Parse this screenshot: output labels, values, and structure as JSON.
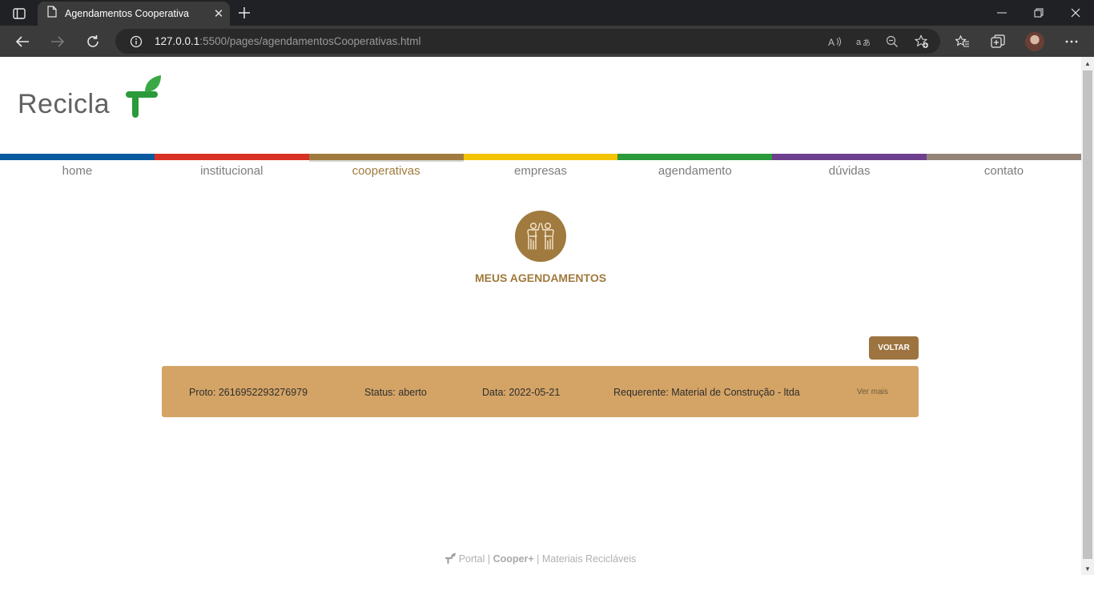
{
  "browser": {
    "tab_title": "Agendamentos Cooperativa",
    "url_host": "127.0.0.1",
    "url_rest": ":5500/pages/agendamentosCooperativas.html"
  },
  "site": {
    "logo_text": "Recicla",
    "nav": [
      {
        "label": "home",
        "color": "#0a5aa0"
      },
      {
        "label": "institucional",
        "color": "#d93025"
      },
      {
        "label": "cooperativas",
        "color": "#a07a3e"
      },
      {
        "label": "empresas",
        "color": "#f2c300"
      },
      {
        "label": "agendamento",
        "color": "#2a9a3a"
      },
      {
        "label": "dúvidas",
        "color": "#6e3f8f"
      },
      {
        "label": "contato",
        "color": "#948478"
      }
    ],
    "active_nav": "cooperativas",
    "accent_color": "#a07a3e"
  },
  "page": {
    "title": "MEUS AGENDAMENTOS",
    "back_label": "VOLTAR",
    "record": {
      "protocol": "Proto: 2616952293276979",
      "status": "Status: aberto",
      "date": "Data: 2022-05-21",
      "requester": "Requerente: Material de Construção - ltda",
      "more_label": "Ver mais"
    }
  },
  "footer": {
    "portal": "Portal",
    "sep1": "|",
    "brand": "Cooper+",
    "sep2": "|",
    "tagline": "Materiais Recicláveis"
  }
}
